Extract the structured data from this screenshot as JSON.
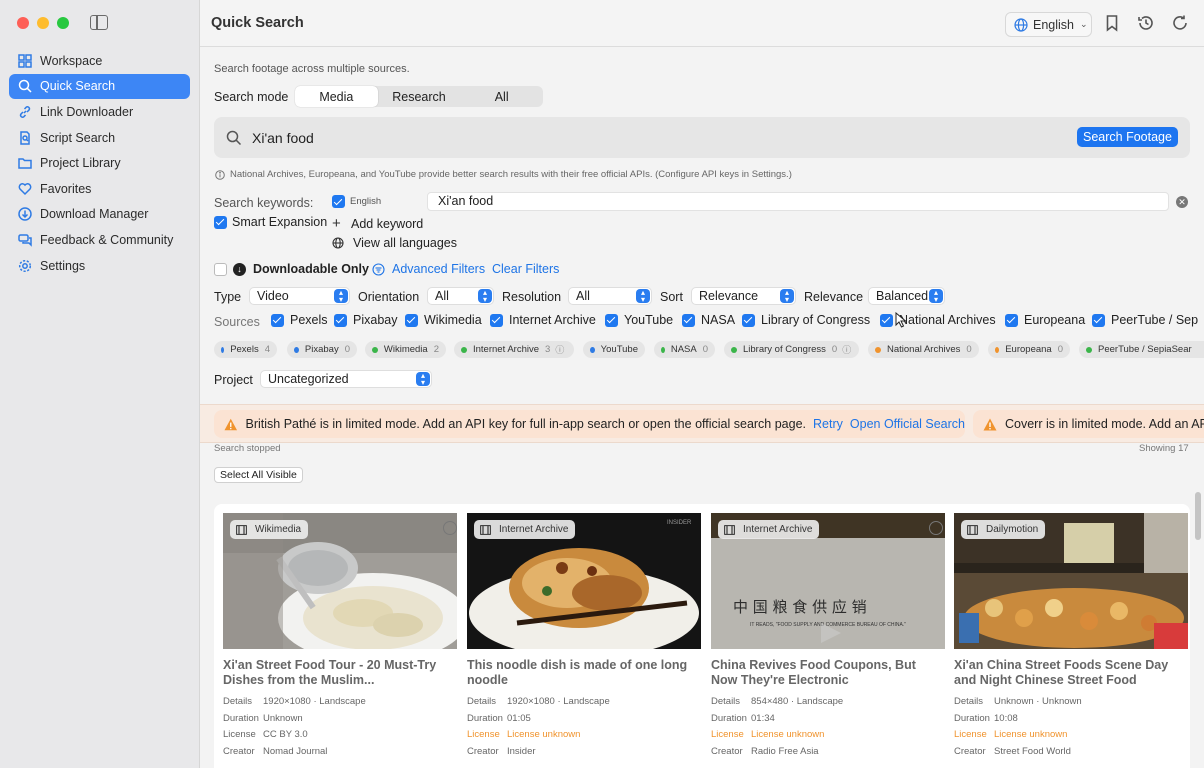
{
  "window": {
    "title": "Quick Search"
  },
  "header": {
    "language": "English"
  },
  "sidebar": {
    "items": [
      {
        "label": "Workspace",
        "icon": "grid-icon"
      },
      {
        "label": "Quick Search",
        "icon": "search-icon",
        "active": true
      },
      {
        "label": "Link Downloader",
        "icon": "link-icon"
      },
      {
        "label": "Script Search",
        "icon": "document-search-icon"
      },
      {
        "label": "Project Library",
        "icon": "folder-icon"
      },
      {
        "label": "Favorites",
        "icon": "heart-icon"
      },
      {
        "label": "Download Manager",
        "icon": "download-icon"
      },
      {
        "label": "Feedback & Community",
        "icon": "chat-icon"
      },
      {
        "label": "Settings",
        "icon": "gear-icon"
      }
    ]
  },
  "search": {
    "subtitle": "Search footage across multiple sources.",
    "mode_label": "Search mode",
    "modes": [
      "Media",
      "Research",
      "All"
    ],
    "active_mode": "Media",
    "query": "Xi'an food",
    "button": "Search Footage",
    "note": "National Archives, Europeana, and YouTube provide better search results with their free official APIs. (Configure API keys in Settings.)"
  },
  "keywords": {
    "label": "Search keywords:",
    "lang": "English",
    "value": "Xi'an food",
    "smart_expansion": "Smart Expansion",
    "add_keyword": "Add keyword",
    "view_all": "View all languages"
  },
  "filters": {
    "downloadable_only": "Downloadable Only",
    "advanced": "Advanced Filters",
    "clear": "Clear Filters",
    "type_label": "Type",
    "type_value": "Video",
    "orientation_label": "Orientation",
    "orientation_value": "All",
    "resolution_label": "Resolution",
    "resolution_value": "All",
    "sort_label": "Sort",
    "sort_value": "Relevance",
    "relevance_label": "Relevance",
    "relevance_value": "Balanced",
    "sources_label": "Sources",
    "project_label": "Project",
    "project_value": "Uncategorized"
  },
  "sources": [
    "Pexels",
    "Pixabay",
    "Wikimedia",
    "Internet Archive",
    "YouTube",
    "NASA",
    "Library of Congress",
    "National Archives",
    "Europeana",
    "PeerTube / Sep"
  ],
  "chips": [
    {
      "name": "Pexels",
      "count": "4",
      "color": "#2f7be4"
    },
    {
      "name": "Pixabay",
      "count": "0",
      "color": "#2f7be4"
    },
    {
      "name": "Wikimedia",
      "count": "2",
      "color": "#3bb54a"
    },
    {
      "name": "Internet Archive",
      "count": "3",
      "color": "#3bb54a"
    },
    {
      "name": "YouTube",
      "count": "",
      "color": "#2f7be4"
    },
    {
      "name": "NASA",
      "count": "0",
      "color": "#3bb54a"
    },
    {
      "name": "Library of Congress",
      "count": "0",
      "color": "#3bb54a"
    },
    {
      "name": "National Archives",
      "count": "0",
      "color": "#f0932d"
    },
    {
      "name": "Europeana",
      "count": "0",
      "color": "#f0932d"
    },
    {
      "name": "PeerTube / SepiaSear",
      "count": "",
      "color": "#3bb54a"
    }
  ],
  "banner": {
    "msg1": "British Pathé is in limited mode. Add an API key for full in-app search or open the official search page.",
    "retry": "Retry",
    "open": "Open Official Search",
    "msg2": "Coverr is in limited mode. Add an API"
  },
  "status": {
    "left": "Search stopped",
    "right": "Showing 17",
    "select_all": "Select All Visible"
  },
  "results": [
    {
      "source": "Wikimedia",
      "title": "Xi'an Street Food Tour - 20 Must-Try Dishes from the Muslim...",
      "details": "1920×1080 · Landscape",
      "duration": "Unknown",
      "license": "CC BY 3.0",
      "license_warn": false,
      "creator": "Nomad Journal"
    },
    {
      "source": "Internet Archive",
      "title": "This noodle dish is made of one long noodle",
      "details": "1920×1080 · Landscape",
      "duration": "01:05",
      "license": "License unknown",
      "license_warn": true,
      "creator": "Insider"
    },
    {
      "source": "Internet Archive",
      "title": "China Revives Food Coupons, But Now They're Electronic",
      "details": "854×480 · Landscape",
      "duration": "01:34",
      "license": "License unknown",
      "license_warn": true,
      "creator": "Radio Free Asia"
    },
    {
      "source": "Dailymotion",
      "title": "Xi'an China Street Foods Scene Day and Night  Chinese Street Food",
      "details": "Unknown · Unknown",
      "duration": "10:08",
      "license": "License unknown",
      "license_warn": true,
      "creator": "Street Food World"
    }
  ],
  "meta_labels": {
    "details": "Details",
    "duration": "Duration",
    "license": "License",
    "creator": "Creator"
  },
  "thumb_text": {
    "archive2_sign": "中 国 粮 食 供 应 销 ",
    "archive2_caption": "IT READS, \"FOOD SUPPLY AND COMMERCE BUREAU OF CHINA.\"",
    "archive1_corner": "INSIDER"
  }
}
